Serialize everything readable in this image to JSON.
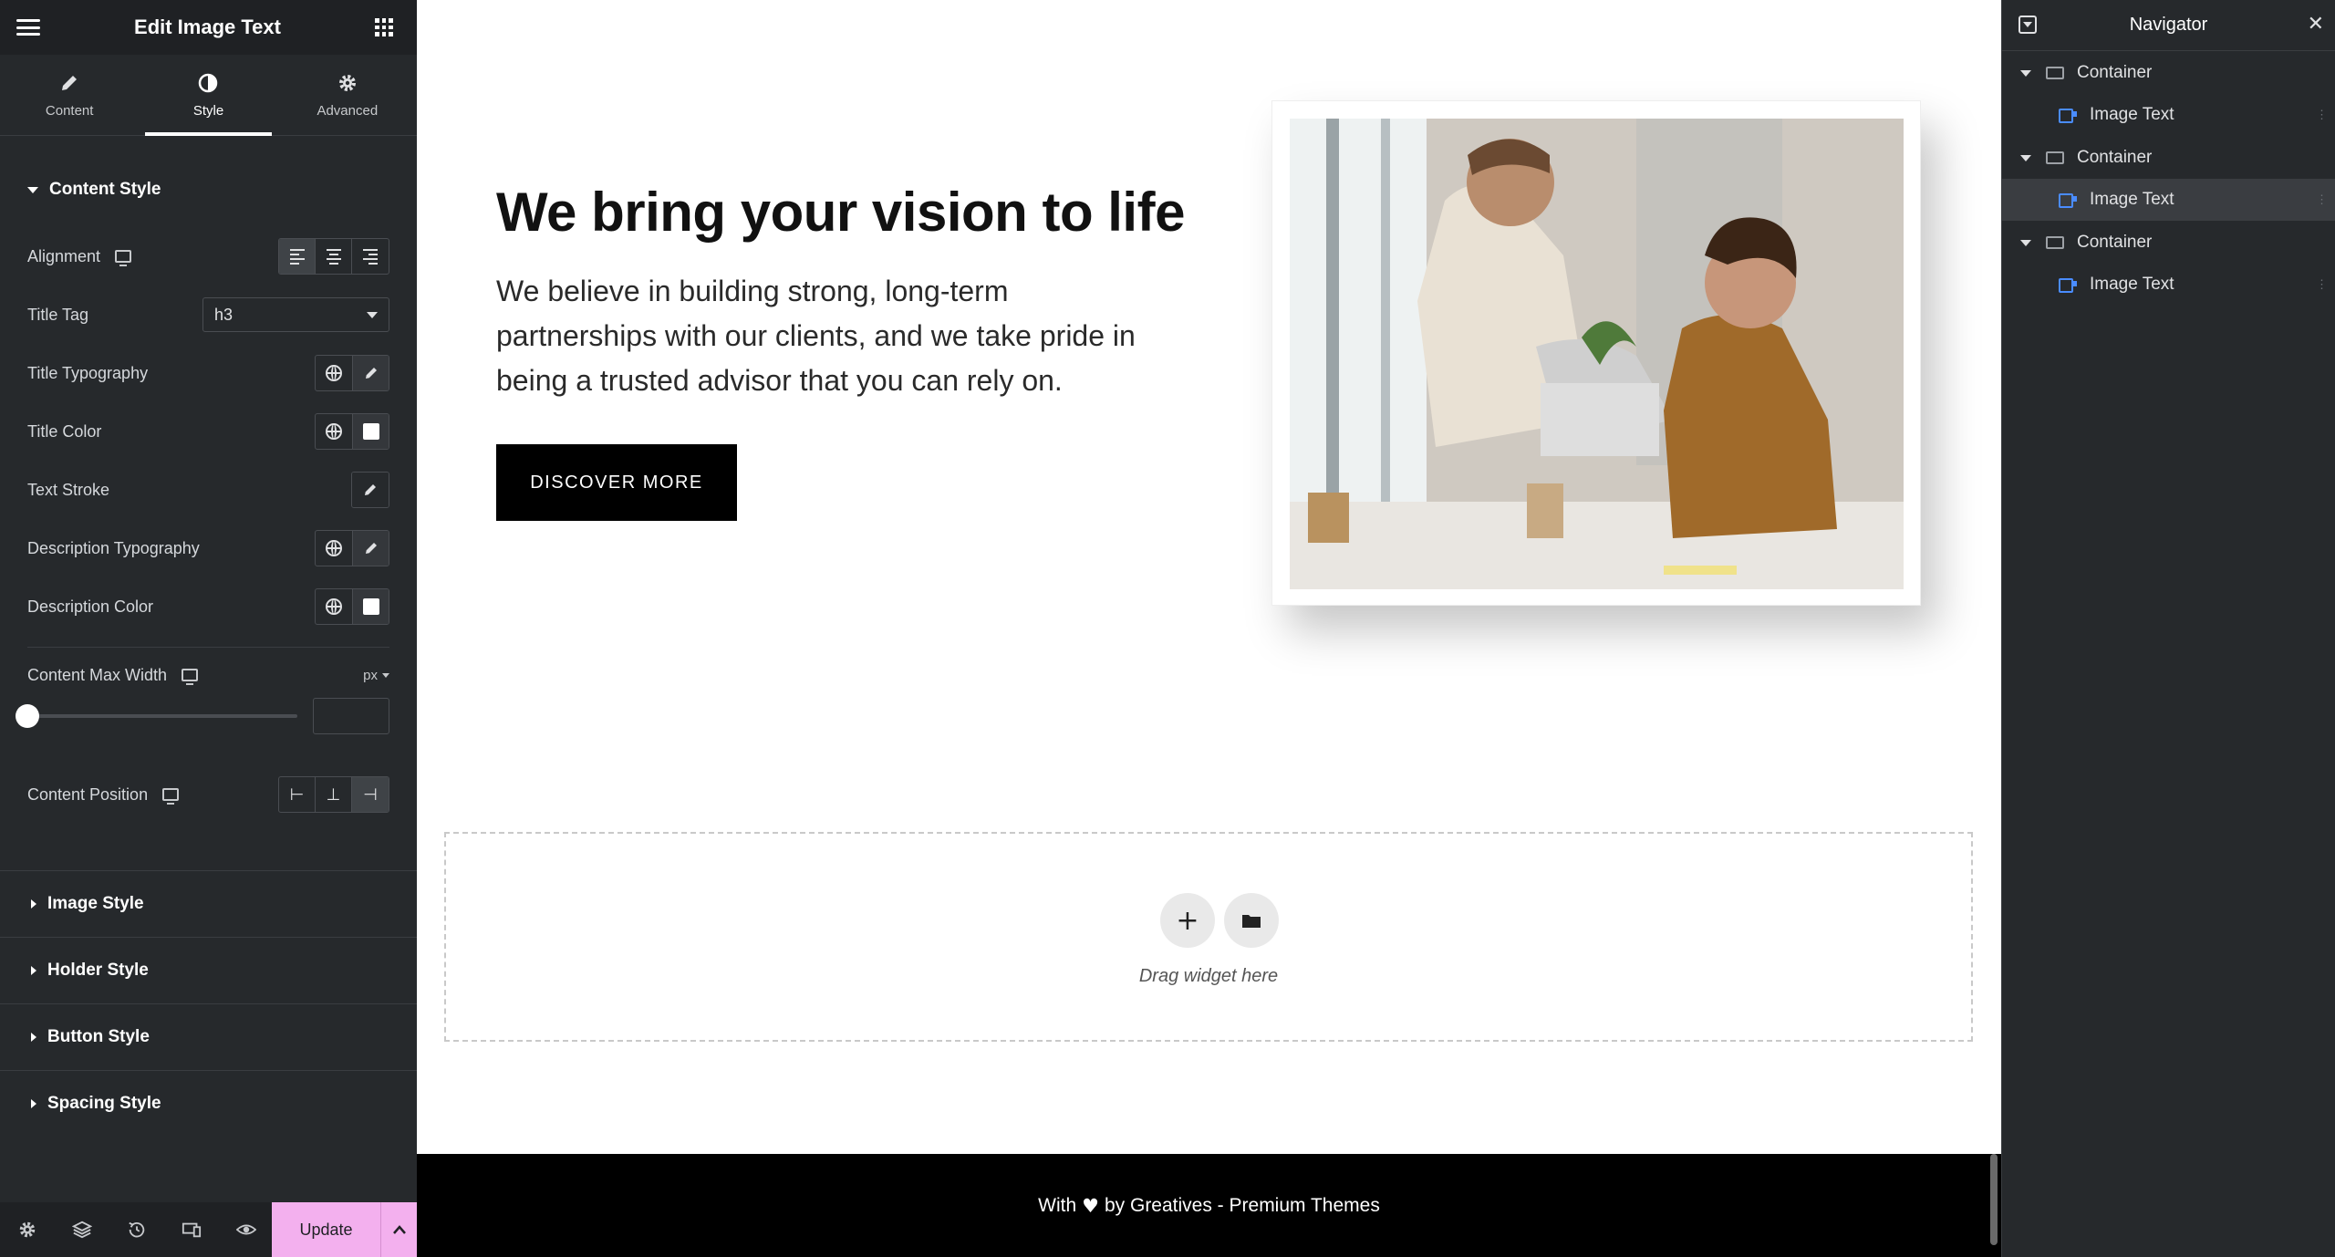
{
  "panel": {
    "title": "Edit Image Text",
    "tabs": [
      {
        "label": "Content",
        "icon": "pencil-icon"
      },
      {
        "label": "Style",
        "icon": "contrast-icon"
      },
      {
        "label": "Advanced",
        "icon": "gear-icon"
      }
    ],
    "active_tab": "Style",
    "section_content_style": "Content Style",
    "controls": {
      "alignment": "Alignment",
      "title_tag": "Title Tag",
      "title_tag_value": "h3",
      "title_typography": "Title Typography",
      "title_color": "Title Color",
      "text_stroke": "Text Stroke",
      "description_typography": "Description Typography",
      "description_color": "Description Color",
      "content_max_width": "Content Max Width",
      "unit": "px",
      "content_max_width_value": "",
      "content_position": "Content Position"
    },
    "collapsed_sections": [
      "Image Style",
      "Holder Style",
      "Button Style",
      "Spacing Style"
    ],
    "footer": {
      "update_label": "Update",
      "icons": [
        "settings-icon",
        "layers-icon",
        "history-icon",
        "responsive-icon",
        "preview-icon"
      ]
    }
  },
  "canvas": {
    "hero_title": "We bring your vision to life",
    "hero_description": "We believe in building strong, long-term partnerships with our clients, and we take pride in being a trusted advisor that you can rely on.",
    "hero_button": "DISCOVER MORE",
    "drop_zone_text": "Drag widget here",
    "footer": {
      "prefix": "With",
      "suffix": "by Greatives - Premium Themes"
    }
  },
  "navigator": {
    "title": "Navigator",
    "items": [
      {
        "label": "Container",
        "type": "container"
      },
      {
        "label": "Image Text",
        "type": "widget"
      },
      {
        "label": "Container",
        "type": "container"
      },
      {
        "label": "Image Text",
        "type": "widget",
        "selected": true
      },
      {
        "label": "Container",
        "type": "container"
      },
      {
        "label": "Image Text",
        "type": "widget"
      }
    ]
  },
  "colors": {
    "panel_bg": "#26292c",
    "update_button": "#f3b0ee",
    "accent_blue": "#4a8cff",
    "hero_button_bg": "#000000"
  }
}
